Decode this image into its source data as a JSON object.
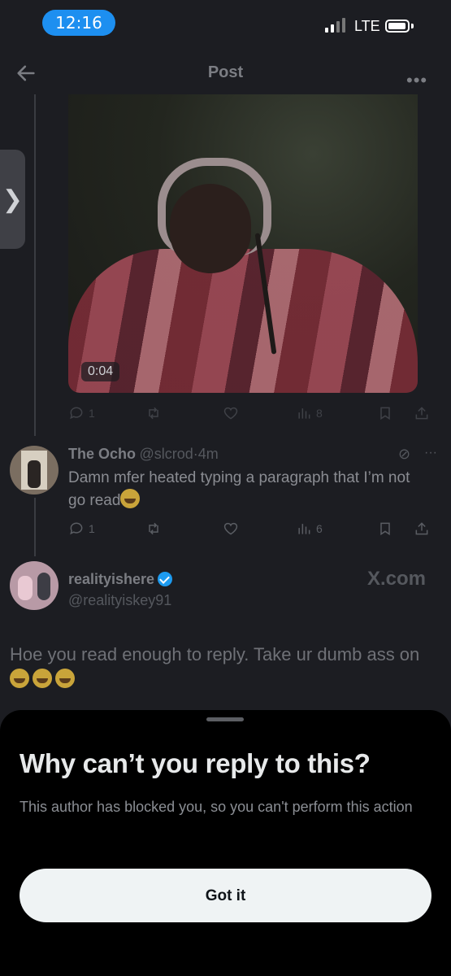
{
  "status_bar": {
    "time": "12:16",
    "network": "LTE"
  },
  "header": {
    "title": "Post",
    "more_icon": "more-horizontal-icon",
    "back_icon": "arrow-left-icon"
  },
  "media": {
    "duration": "0:04"
  },
  "post_actions": {
    "replies": "1",
    "views": "8"
  },
  "reply": {
    "name": "The Ocho",
    "handle": "@slcrod",
    "time": "4m",
    "text": "Damn mfer heated typing a paragraph that I’m not go read",
    "replies": "1",
    "views": "6"
  },
  "focused_post": {
    "name": "realityishere",
    "handle": "@realityiskey91",
    "watermark": "X.com",
    "text": "Hoe you read enough to reply. Take ur dumb ass on"
  },
  "sheet": {
    "title": "Why can’t you reply to this?",
    "body": "This author has blocked you, so you can't perform this action",
    "button": "Got it"
  },
  "colors": {
    "accent": "#1d9bf0",
    "time_pill": "#1d8ff0",
    "sheet_bg": "#000000",
    "button_bg": "#eff3f4"
  }
}
